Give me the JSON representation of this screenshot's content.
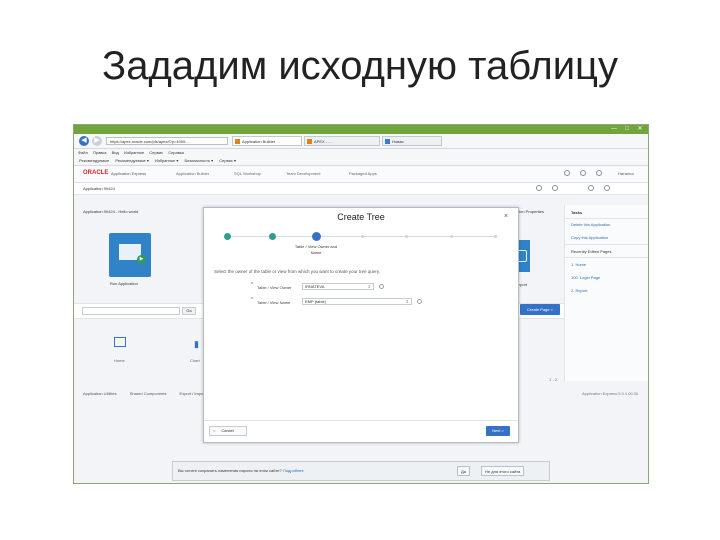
{
  "slide": {
    "title": "Зададим исходную таблицу"
  },
  "browser": {
    "nav": {
      "back": "◀",
      "forward": "▶"
    },
    "url": "https://apex.oracle.com/pls/apex/f?p=4000:...",
    "tabs": [
      "Application Builder",
      "APEX - ...",
      "Новая"
    ],
    "window_buttons": {
      "minimize": "—",
      "maximize": "□",
      "close": "✕"
    },
    "menu": [
      "Файл",
      "Правка",
      "Вид",
      "Избранное",
      "Сервис",
      "Справка"
    ],
    "favorites": [
      "Рекомендуемые",
      "Рекомендуемые ▾",
      "Избранное ▾",
      "Безопасность ▾",
      "Сервис ▾"
    ]
  },
  "apex": {
    "brand": "ORACLE",
    "product": "Application Express",
    "menus": [
      "Application Builder",
      "SQL Workshop",
      "Team Development",
      "Packaged Apps"
    ],
    "user": "Наталья",
    "app_id": "Application 90424",
    "breadcrumb": "Application 90424 - Hello world",
    "run_app": "Run Application",
    "report": "Report",
    "properties": "Application Properties",
    "search": {
      "placeholder": "",
      "go": "Go"
    },
    "create_page": "Create Page >",
    "tiles": [
      "Home",
      "Chart"
    ],
    "pager": "1 - 2",
    "footer_links": [
      "Application Utilities",
      "Shared Components",
      "Export / Import"
    ],
    "copyright": "Application Express 5.0.1.00.06",
    "side": {
      "tasks_title": "Tasks",
      "tasks": [
        "Delete this Application",
        "Copy this Application"
      ],
      "recent_title": "Recently Edited Pages",
      "recent": [
        "1. Home",
        "100. Login Page",
        "2. Report"
      ]
    }
  },
  "dialog": {
    "title": "Create Tree",
    "close": "×",
    "step_label": "Table / View Owner and Name",
    "instruction": "Select the owner of the table or view from which you want to create your tree query.",
    "fields": [
      {
        "label": "Table / View Owner",
        "value": "IRNATEVA"
      },
      {
        "label": "Table / View Name",
        "value": "EMP (table)"
      }
    ],
    "cancel": "Cancel",
    "cancel_arrow": "<",
    "next": "Next >"
  },
  "notification": {
    "question": "Вы хотите сохранить изменения пароля на этом сайте?",
    "link": "Подробнее",
    "yes": "Да",
    "no": "Не для этого сайта"
  }
}
